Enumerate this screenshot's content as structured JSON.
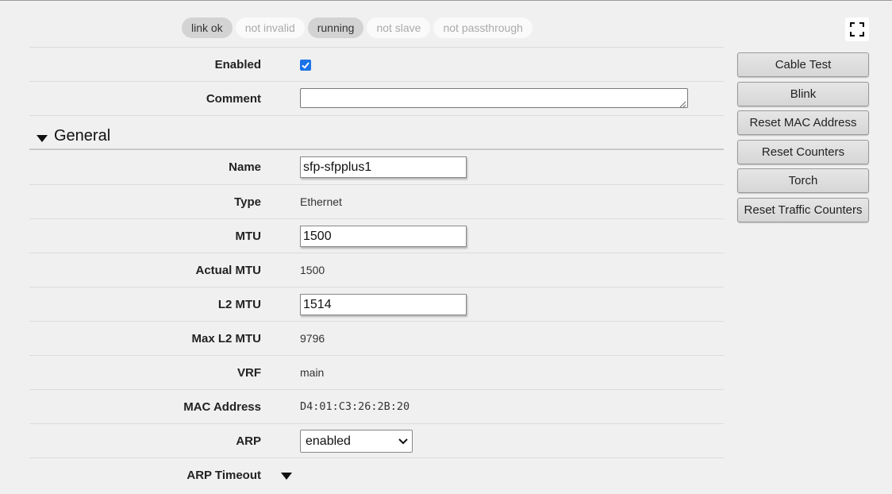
{
  "status": [
    {
      "label": "link ok",
      "active": true
    },
    {
      "label": "not invalid",
      "active": false
    },
    {
      "label": "running",
      "active": true
    },
    {
      "label": "not slave",
      "active": false
    },
    {
      "label": "not passthrough",
      "active": false
    }
  ],
  "form": {
    "enabled_label": "Enabled",
    "enabled_checked": true,
    "comment_label": "Comment",
    "comment_value": ""
  },
  "general": {
    "section_title": "General",
    "name_label": "Name",
    "name_value": "sfp-sfpplus1",
    "type_label": "Type",
    "type_value": "Ethernet",
    "mtu_label": "MTU",
    "mtu_value": "1500",
    "actual_mtu_label": "Actual MTU",
    "actual_mtu_value": "1500",
    "l2mtu_label": "L2 MTU",
    "l2mtu_value": "1514",
    "max_l2mtu_label": "Max L2 MTU",
    "max_l2mtu_value": "9796",
    "vrf_label": "VRF",
    "vrf_value": "main",
    "mac_label": "MAC Address",
    "mac_value": "D4:01:C3:26:2B:20",
    "arp_label": "ARP",
    "arp_value": "enabled",
    "arp_timeout_label": "ARP Timeout"
  },
  "actions": {
    "cable_test": "Cable Test",
    "blink": "Blink",
    "reset_mac": "Reset MAC Address",
    "reset_counters": "Reset Counters",
    "torch": "Torch",
    "reset_traffic": "Reset Traffic Counters"
  },
  "icons": {
    "fullscreen": "fullscreen-icon",
    "collapse": "triangle-down-icon",
    "select_arrow": "chevron-down-icon"
  },
  "colors": {
    "checkbox": "#1a73e8",
    "pill_active": "#d3d3d3",
    "pill_inactive": "#fafafa"
  }
}
